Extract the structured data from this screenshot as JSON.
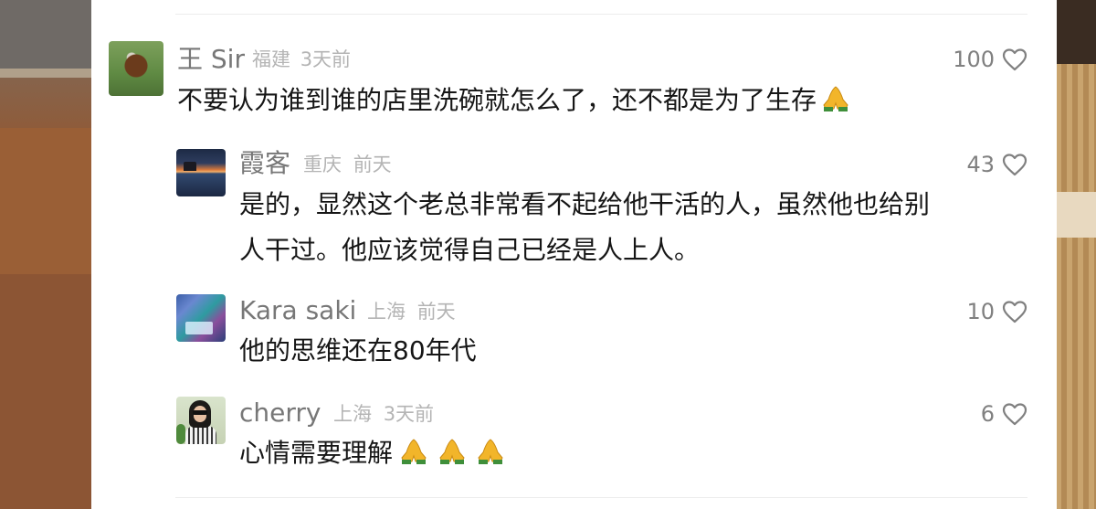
{
  "comments": [
    {
      "user": "王 Sir",
      "location": "福建",
      "time": "3天前",
      "likes": "100",
      "lines": [
        "不要认为谁到谁的店里洗碗就怎么了，还不都是为了生存"
      ],
      "emoji_count": 1,
      "emoji": "folded-hands"
    },
    {
      "user": "霞客",
      "location": "重庆",
      "time": "前天",
      "likes": "43",
      "lines": [
        "是的，显然这个老总非常看不起给他干活的人，虽然他也给别",
        "人干过。他应该觉得自己已经是人上人。"
      ]
    },
    {
      "user": "Kara saki",
      "location": "上海",
      "time": "前天",
      "likes": "10",
      "lines": [
        "他的思维还在80年代"
      ]
    },
    {
      "user": "cherry",
      "location": "上海",
      "time": "3天前",
      "likes": "6",
      "lines": [
        "心情需要理解"
      ],
      "emoji_count": 3,
      "emoji": "folded-hands"
    }
  ],
  "icons": {
    "like": "heart-outline-icon",
    "reaction": "folded-hands-emoji"
  },
  "colors": {
    "name": "#777777",
    "meta": "#b4b4b4",
    "text": "#161616",
    "likes": "#808080",
    "emoji": "#f2b52a"
  }
}
